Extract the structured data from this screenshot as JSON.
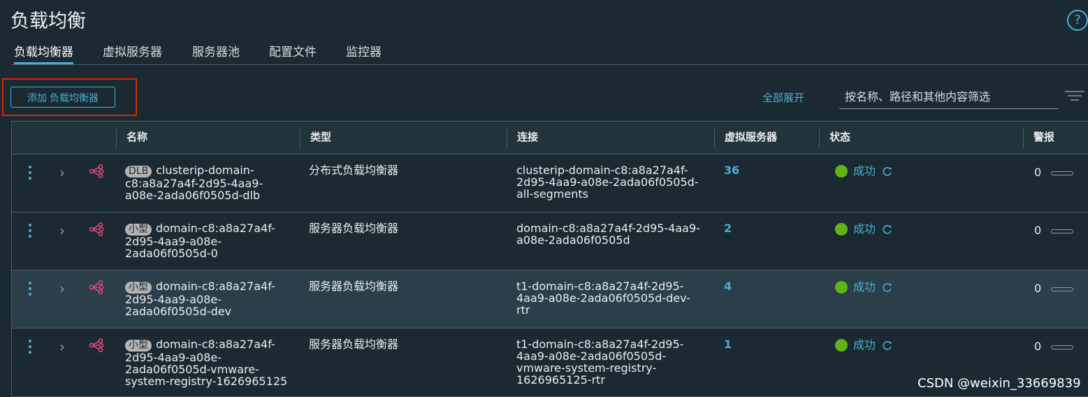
{
  "page": {
    "title": "负载均衡",
    "help_glyph": "?"
  },
  "tabs": [
    {
      "label": "负载均衡器",
      "active": true
    },
    {
      "label": "虚拟服务器",
      "active": false
    },
    {
      "label": "服务器池",
      "active": false
    },
    {
      "label": "配置文件",
      "active": false
    },
    {
      "label": "监控器",
      "active": false
    }
  ],
  "toolbar": {
    "add_label": "添加 负载均衡器",
    "expand_all_label": "全部展开",
    "filter_placeholder": "按名称、路径和其他内容筛选"
  },
  "table": {
    "headers": {
      "name": "名称",
      "type": "类型",
      "connection": "连接",
      "virtual_servers": "虚拟服务器",
      "status": "状态",
      "alarms": "警报"
    },
    "rows": [
      {
        "badge": "DLB",
        "name_lines": [
          "clusterip-domain-",
          "c8:a8a27a4f-2d95-4aa9-",
          "a08e-2ada06f0505d-dlb"
        ],
        "type": "分布式负载均衡器",
        "connection_lines": [
          "clusterip-domain-c8:a8a27a4f-",
          "2d95-4aa9-a08e-2ada06f0505d-",
          "all-segments"
        ],
        "virtual_servers": "36",
        "status": "成功",
        "alarms": "0"
      },
      {
        "badge": "小型",
        "name_lines": [
          "domain-c8:a8a27a4f-",
          "2d95-4aa9-a08e-",
          "2ada06f0505d-0"
        ],
        "type": "服务器负载均衡器",
        "connection_lines": [
          "domain-c8:a8a27a4f-2d95-4aa9-",
          "a08e-2ada06f0505d"
        ],
        "virtual_servers": "2",
        "status": "成功",
        "alarms": "0"
      },
      {
        "badge": "小型",
        "name_lines": [
          "domain-c8:a8a27a4f-",
          "2d95-4aa9-a08e-",
          "2ada06f0505d-dev"
        ],
        "type": "服务器负载均衡器",
        "connection_lines": [
          "t1-domain-c8:a8a27a4f-2d95-",
          "4aa9-a08e-2ada06f0505d-dev-",
          "rtr"
        ],
        "virtual_servers": "4",
        "status": "成功",
        "alarms": "0"
      },
      {
        "badge": "小型",
        "name_lines": [
          "domain-c8:a8a27a4f-",
          "2d95-4aa9-a08e-",
          "2ada06f0505d-vmware-",
          "system-registry-1626965125"
        ],
        "type": "服务器负载均衡器",
        "connection_lines": [
          "t1-domain-c8:a8a27a4f-2d95-",
          "4aa9-a08e-2ada06f0505d-",
          "vmware-system-registry-",
          "1626965125-rtr"
        ],
        "virtual_servers": "1",
        "status": "成功",
        "alarms": "0"
      }
    ]
  },
  "watermark": "CSDN @weixin_33669839",
  "colors": {
    "accent": "#49afd9",
    "success": "#60b515",
    "lb_icon": "#e0457b",
    "highlight_box": "#e12200",
    "background": "#1b2a32"
  },
  "icons": {
    "help": "help-circle-icon",
    "row_actions": "kebab-menu-icon",
    "expand_row": "chevron-right-icon",
    "load_balancer": "load-balancer-icon",
    "refresh": "refresh-icon",
    "filter": "filter-lines-icon"
  }
}
